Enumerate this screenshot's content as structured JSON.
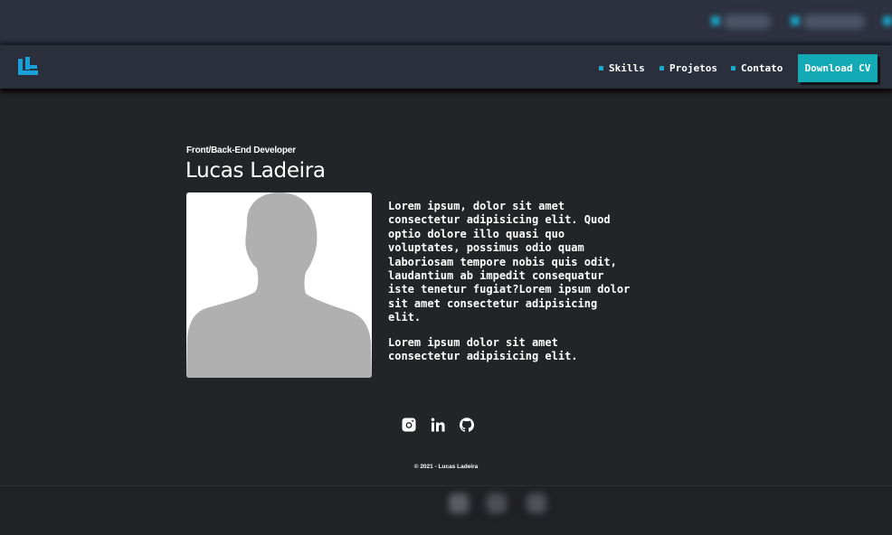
{
  "nav": {
    "logo_alt": "LL",
    "items": [
      {
        "label": "Skills"
      },
      {
        "label": "Projetos"
      },
      {
        "label": "Contato"
      }
    ],
    "download_label": "Download CV"
  },
  "hero": {
    "role": "Front/Back-End Developer",
    "name": "Lucas Ladeira",
    "bio": [
      "Lorem ipsum, dolor sit amet consectetur adipisicing elit. Quod optio dolore illo quasi quo voluptates, possimus odio quam laboriosam tempore nobis quis odit, laudantium ab impedit consequatur iste tenetur fugiat?Lorem ipsum dolor sit amet consectetur adipisicing elit.",
      "Lorem ipsum dolor sit amet consectetur adipisicing elit."
    ]
  },
  "social": [
    {
      "icon": "instagram-icon"
    },
    {
      "icon": "linkedin-icon"
    },
    {
      "icon": "github-icon"
    }
  ],
  "footer": {
    "copyright": "© 2021 - Lucas Ladeira"
  },
  "colors": {
    "accent": "#19a8c9",
    "button": "#14aab5",
    "background": "#232428",
    "navbar": "#2b2f3c"
  }
}
